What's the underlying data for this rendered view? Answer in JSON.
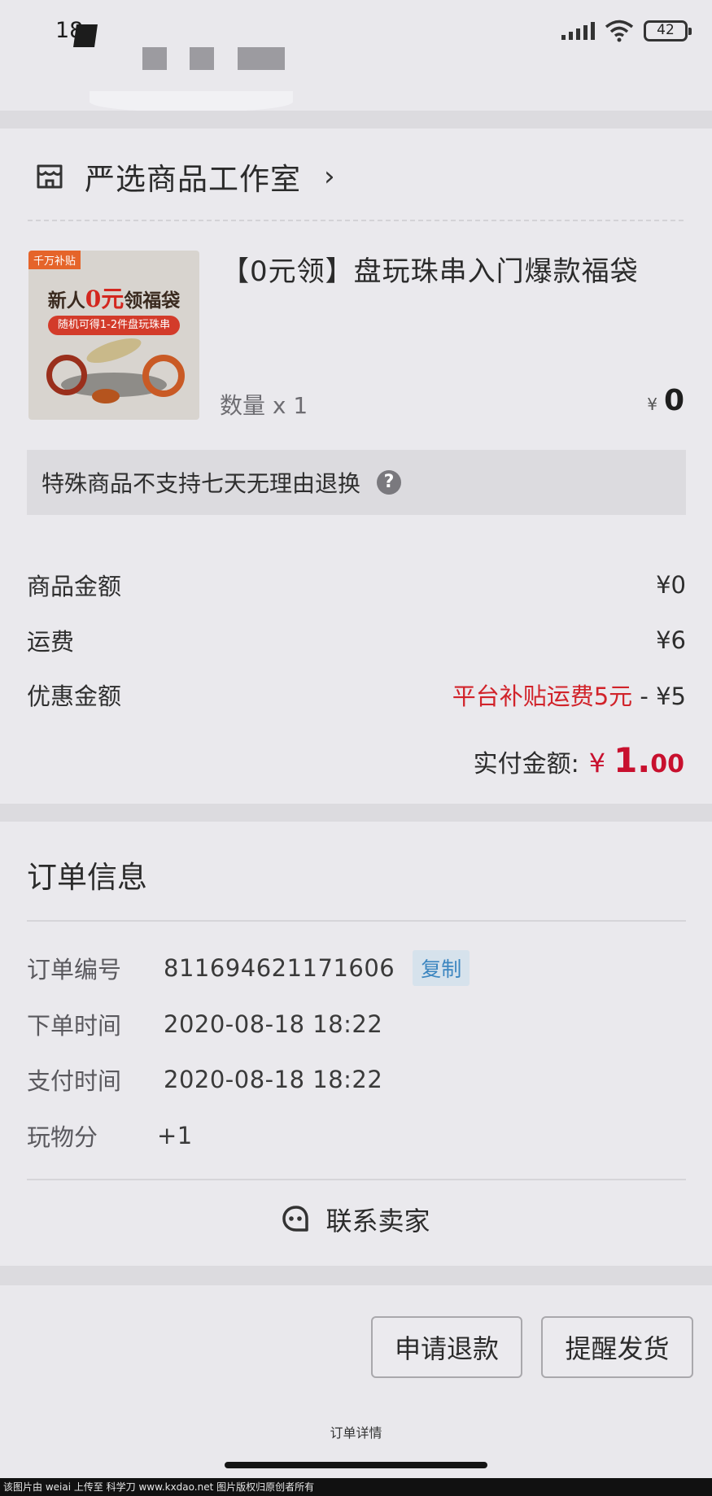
{
  "status_bar": {
    "time": "18",
    "battery": "42"
  },
  "shop": {
    "name": "严选商品工作室",
    "chevron": "›",
    "icon": "shop-icon"
  },
  "product": {
    "image_tag": "千万补贴",
    "image_title_prefix": "新人",
    "image_title_highlight": "0元",
    "image_title_suffix": "领福袋",
    "image_ribbon": "随机可得1-2件盘玩珠串",
    "title": "【0元领】盘玩珠串入门爆款福袋",
    "quantity_label": "数量 x 1",
    "price_symbol": "¥",
    "price": "0"
  },
  "notice": {
    "text": "特殊商品不支持七天无理由退换",
    "help_glyph": "?"
  },
  "fees": {
    "goods_label": "商品金额",
    "goods_value": "¥0",
    "shipping_label": "运费",
    "shipping_value": "¥6",
    "discount_label": "优惠金额",
    "discount_note": "平台补贴运费5元",
    "discount_value": " - ¥5"
  },
  "total": {
    "label": "实付金额:",
    "symbol": "¥",
    "integer": "1.",
    "decimal": "00"
  },
  "order_info": {
    "title": "订单信息",
    "order_no_label": "订单编号",
    "order_no": "811694621171606",
    "copy_label": "复制",
    "order_time_label": "下单时间",
    "order_time": "2020-08-18 18:22",
    "pay_time_label": "支付时间",
    "pay_time": "2020-08-18 18:22",
    "points_label": "玩物分",
    "points": "+1"
  },
  "contact": {
    "label": "联系卖家"
  },
  "actions": {
    "refund_label": "申请退款",
    "remind_label": "提醒发货"
  },
  "footer": {
    "page_label": "订单详情",
    "watermark": "该图片由 weiai 上传至 科学刀 www.kxdao.net 图片版权归原创者所有"
  },
  "colors": {
    "accent_red": "#c8102e",
    "subsidy_red": "#d1232a",
    "copy_blue": "#3c86c0"
  }
}
